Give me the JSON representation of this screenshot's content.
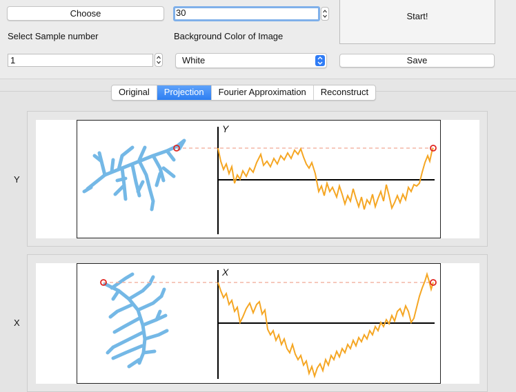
{
  "controls": {
    "choose_label": "Choose",
    "count_value": "30",
    "sample_label": "Select Sample number",
    "sample_value": "1",
    "bg_label": "Background Color of Image",
    "bg_value": "White",
    "start_label": "Start!",
    "save_label": "Save"
  },
  "tabs": [
    "Original",
    "Projection",
    "Fourier Approximation",
    "Reconstruct"
  ],
  "active_tab": "Projection",
  "rows": [
    {
      "label": "Y",
      "axis_label": "Y"
    },
    {
      "label": "X",
      "axis_label": "X"
    }
  ],
  "colors": {
    "shape": "#74b8e6",
    "signal": "#f5a623",
    "marker": "#e0241f",
    "guide": "#f4b6a6",
    "active_tab": "#2d7ef2"
  },
  "icons": {
    "stepper": "stepper-arrows-icon",
    "select": "popup-arrows-icon",
    "marker": "circle-marker-icon"
  }
}
